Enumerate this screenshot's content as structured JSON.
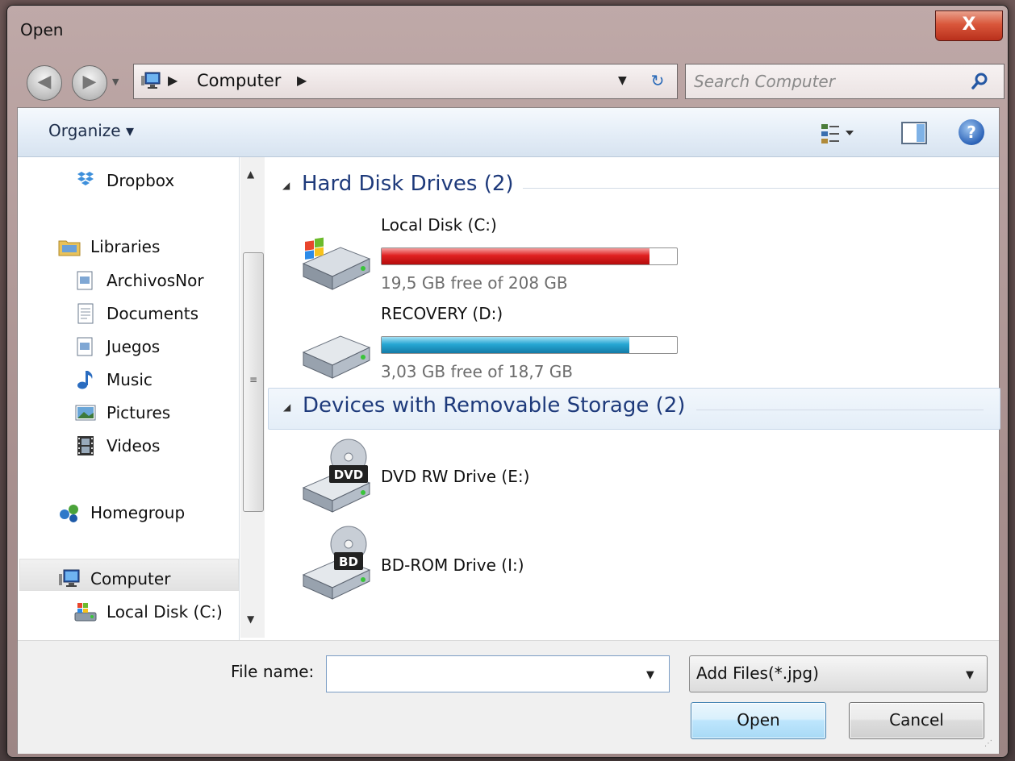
{
  "window": {
    "title": "Open",
    "close_label": "X"
  },
  "nav": {
    "back_glyph": "◀",
    "forward_glyph": "▶",
    "history_glyph": "▼"
  },
  "address": {
    "crumb_sep": "▶",
    "location": "Computer",
    "trailing_sep": "▶",
    "dropdown_glyph": "▼",
    "refresh_glyph": "↻"
  },
  "search": {
    "placeholder": "Search Computer"
  },
  "toolbar": {
    "organize_label": "Organize ▾",
    "help_label": "?"
  },
  "sidebar": {
    "items": [
      {
        "label": "Dropbox",
        "icon": "dropbox-icon"
      },
      {
        "label": "Libraries",
        "icon": "libraries-icon"
      },
      {
        "label": "ArchivosNor",
        "icon": "library-icon"
      },
      {
        "label": "Documents",
        "icon": "documents-icon"
      },
      {
        "label": "Juegos",
        "icon": "library-icon"
      },
      {
        "label": "Music",
        "icon": "music-icon"
      },
      {
        "label": "Pictures",
        "icon": "pictures-icon"
      },
      {
        "label": "Videos",
        "icon": "videos-icon"
      },
      {
        "label": "Homegroup",
        "icon": "homegroup-icon"
      },
      {
        "label": "Computer",
        "icon": "computer-icon"
      },
      {
        "label": "Local Disk (C:)",
        "icon": "local-disk-icon"
      }
    ],
    "scroll_up": "▲",
    "scroll_down": "▼",
    "scroll_grip": "≡"
  },
  "groups": [
    {
      "title": "Hard Disk Drives (2)",
      "collapse_glyph": "◢"
    },
    {
      "title": "Devices with Removable Storage (2)",
      "collapse_glyph": "◢"
    }
  ],
  "drives": [
    {
      "name": "Local Disk (C:)",
      "free_text": "19,5 GB free of 208 GB",
      "used_fraction": 0.906,
      "bar_color": "#d41414"
    },
    {
      "name": "RECOVERY (D:)",
      "free_text": "3,03 GB free of 18,7 GB",
      "used_fraction": 0.838,
      "bar_color": "#1d9cc9"
    }
  ],
  "devices": [
    {
      "name": "DVD RW Drive (E:)",
      "badge": "DVD"
    },
    {
      "name": "BD-ROM Drive (I:)",
      "badge": "BD"
    }
  ],
  "footer": {
    "file_name_label": "File name:",
    "file_name_value": "",
    "file_name_drop": "▼",
    "file_type": "Add Files(*.jpg)",
    "file_type_drop": "▼",
    "open_label": "Open",
    "cancel_label": "Cancel",
    "grip": "⋰"
  },
  "colors": {
    "link_blue": "#1e3a7b",
    "accent": "#3c7fb1"
  }
}
